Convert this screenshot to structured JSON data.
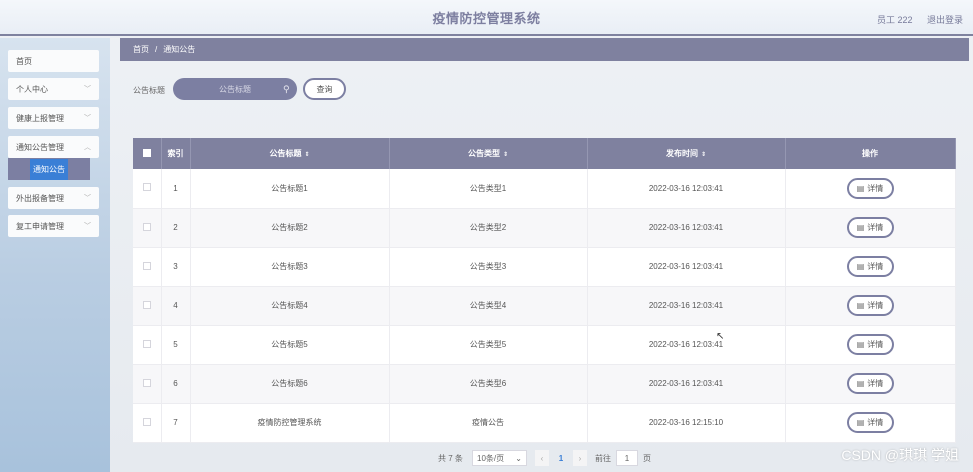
{
  "header": {
    "title": "疫情防控管理系统",
    "user": "员工 222",
    "logout": "退出登录"
  },
  "sidebar": {
    "items": [
      {
        "label": "首页"
      },
      {
        "label": "个人中心"
      },
      {
        "label": "健康上报管理"
      },
      {
        "label": "通知公告管理"
      },
      {
        "label": "外出报备管理"
      },
      {
        "label": "复工申请管理"
      }
    ],
    "active_sub": "通知公告"
  },
  "breadcrumb": {
    "home": "首页",
    "separator": "/",
    "current": "通知公告"
  },
  "search": {
    "label": "公告标题",
    "placeholder": "公告标题",
    "button": "查询"
  },
  "table": {
    "headers": {
      "index": "索引",
      "title": "公告标题",
      "type": "公告类型",
      "time": "发布时间",
      "actions": "操作"
    },
    "detail_label": "详情",
    "rows": [
      {
        "index": "1",
        "title": "公告标题1",
        "type": "公告类型1",
        "time": "2022-03-16 12:03:41"
      },
      {
        "index": "2",
        "title": "公告标题2",
        "type": "公告类型2",
        "time": "2022-03-16 12:03:41"
      },
      {
        "index": "3",
        "title": "公告标题3",
        "type": "公告类型3",
        "time": "2022-03-16 12:03:41"
      },
      {
        "index": "4",
        "title": "公告标题4",
        "type": "公告类型4",
        "time": "2022-03-16 12:03:41"
      },
      {
        "index": "5",
        "title": "公告标题5",
        "type": "公告类型5",
        "time": "2022-03-16 12:03:41"
      },
      {
        "index": "6",
        "title": "公告标题6",
        "type": "公告类型6",
        "time": "2022-03-16 12:03:41"
      },
      {
        "index": "7",
        "title": "疫情防控管理系统",
        "type": "疫情公告",
        "time": "2022-03-16 12:15:10"
      }
    ]
  },
  "pagination": {
    "total": "共 7 条",
    "page_size": "10条/页",
    "current_page": "1",
    "goto_label": "前往",
    "goto_value": "1",
    "page_unit": "页"
  },
  "watermark": "CSDN @琪琪 学姐",
  "colors": {
    "accent": "#7f819f",
    "active": "#3a7fd6"
  }
}
